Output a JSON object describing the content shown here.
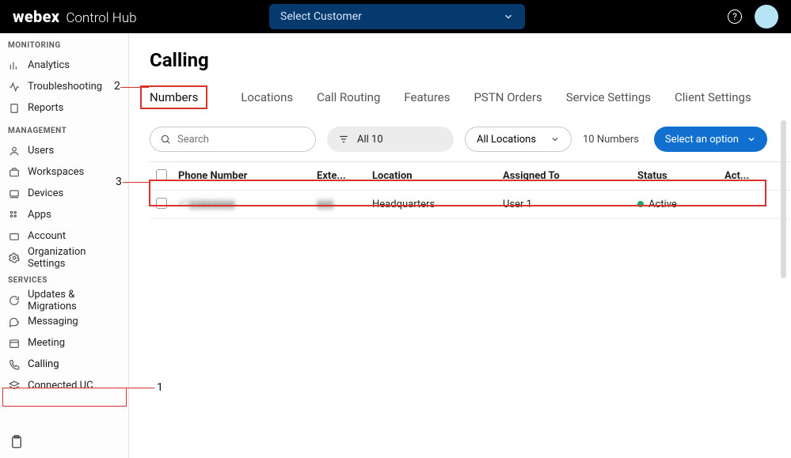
{
  "header": {
    "brand_logo": "webex",
    "brand_sub": "Control Hub",
    "customer_select": "Select Customer"
  },
  "sidebar": {
    "sections": [
      {
        "title": "MONITORING",
        "items": [
          {
            "label": "Analytics",
            "icon": "bar-chart-icon"
          },
          {
            "label": "Troubleshooting",
            "icon": "pulse-icon"
          },
          {
            "label": "Reports",
            "icon": "document-icon"
          }
        ]
      },
      {
        "title": "MANAGEMENT",
        "items": [
          {
            "label": "Users",
            "icon": "user-icon"
          },
          {
            "label": "Workspaces",
            "icon": "briefcase-icon"
          },
          {
            "label": "Devices",
            "icon": "device-icon"
          },
          {
            "label": "Apps",
            "icon": "grid-icon"
          },
          {
            "label": "Account",
            "icon": "folder-icon"
          },
          {
            "label": "Organization Settings",
            "icon": "gear-icon"
          }
        ]
      },
      {
        "title": "SERVICES",
        "items": [
          {
            "label": "Updates & Migrations",
            "icon": "refresh-icon"
          },
          {
            "label": "Messaging",
            "icon": "message-icon"
          },
          {
            "label": "Meeting",
            "icon": "calendar-icon"
          },
          {
            "label": "Calling",
            "icon": "phone-icon",
            "active": true
          },
          {
            "label": "Connected UC",
            "icon": "stack-icon"
          }
        ]
      }
    ]
  },
  "main": {
    "title": "Calling",
    "tabs": [
      "Numbers",
      "Locations",
      "Call Routing",
      "Features",
      "PSTN Orders",
      "Service Settings",
      "Client Settings"
    ],
    "active_tab": 0,
    "toolbar": {
      "search_placeholder": "Search",
      "filter_label": "All 10",
      "location_label": "All Locations",
      "count_label": "10 Numbers",
      "action_label": "Select an option"
    },
    "table": {
      "headers": [
        "",
        "Phone Number",
        "Exte...",
        "Location",
        "Assigned To",
        "Status",
        "Act..."
      ],
      "rows": [
        {
          "phone": "+1▮▮▮▮▮▮▮▮",
          "ext": "▮▮▮",
          "location": "Headquarters",
          "assigned": "User 1",
          "status": "Active"
        }
      ]
    }
  },
  "annotations": {
    "a1": "1",
    "a2": "2",
    "a3": "3"
  }
}
